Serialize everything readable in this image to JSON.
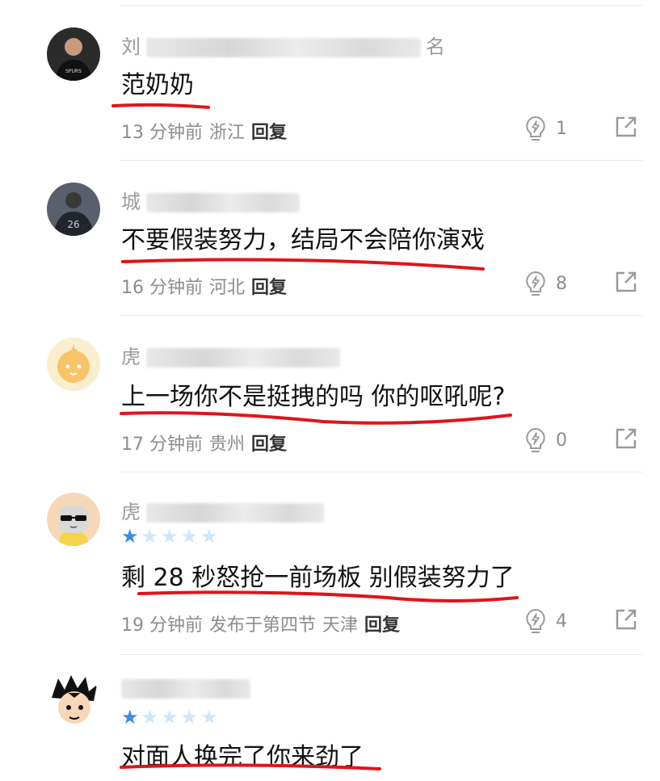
{
  "comments": [
    {
      "username_visible": "刘",
      "username_tail": "名",
      "text": "范奶奶",
      "time": "13 分钟前",
      "extra": "",
      "location": "浙江",
      "reply_label": "回复",
      "likes": "1",
      "stars": 0,
      "avatar_icon": "player-avatar-icon"
    },
    {
      "username_visible": "城",
      "username_tail": "",
      "text": "不要假装努力，结局不会陪你演戏",
      "time": "16 分钟前",
      "extra": "",
      "location": "河北",
      "reply_label": "回复",
      "likes": "8",
      "stars": 0,
      "avatar_icon": "player-26-avatar-icon"
    },
    {
      "username_visible": "虎",
      "username_tail": "",
      "text": "上一场你不是挺拽的吗 你的呕吼呢?",
      "time": "17 分钟前",
      "extra": "",
      "location": "贵州",
      "reply_label": "回复",
      "likes": "0",
      "stars": 0,
      "avatar_icon": "cartoon-face-avatar-icon"
    },
    {
      "username_visible": "虎",
      "username_tail": "",
      "text": "剩 28 秒怒抢一前场板 别假装努力了",
      "time": "19 分钟前",
      "extra": "发布于第四节",
      "location": "天津",
      "reply_label": "回复",
      "likes": "4",
      "stars": 1,
      "avatar_icon": "cool-glasses-avatar-icon"
    },
    {
      "username_visible": "",
      "username_tail": "",
      "text": "对面人换完了你来劲了",
      "time": "",
      "extra": "",
      "location": "",
      "reply_label": "",
      "likes": "",
      "stars": 1,
      "avatar_icon": "goku-avatar-icon"
    }
  ],
  "colors": {
    "star_active": "#3a8de0",
    "star_inactive": "#cfe6fb",
    "underline": "#e0141b",
    "meta_text": "#8c8c8c"
  }
}
